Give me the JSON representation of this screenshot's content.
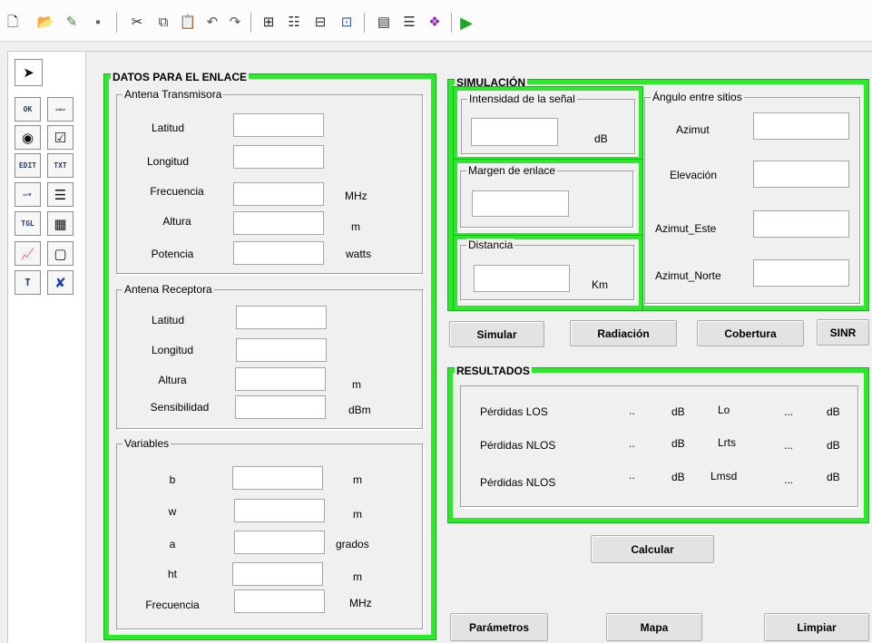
{
  "toolbar": {
    "icons": [
      "new-file-icon",
      "open-folder-icon",
      "edit-icon",
      "save-icon",
      "cut-icon",
      "copy-icon",
      "paste-icon",
      "undo-icon",
      "redo-icon",
      "align-icon",
      "menu-editor-icon",
      "tab-order-icon",
      "toolbar-editor-icon",
      "editor-icon",
      "property-inspector-icon",
      "object-browser-icon",
      "run-icon"
    ]
  },
  "palette": {
    "items": [
      {
        "icon": "pointer-icon",
        "text": "➤"
      },
      {
        "icon": "push-button-icon",
        "text": "OK"
      },
      {
        "icon": "slider-icon",
        "text": "▭▭"
      },
      {
        "icon": "radio-button-icon",
        "text": "◉"
      },
      {
        "icon": "checkbox-icon",
        "text": "☑"
      },
      {
        "icon": "edit-text-icon",
        "text": "EDIT"
      },
      {
        "icon": "static-text-icon",
        "text": "TXT"
      },
      {
        "icon": "popup-menu-icon",
        "text": "▭▾"
      },
      {
        "icon": "listbox-icon",
        "text": "☰"
      },
      {
        "icon": "toggle-button-icon",
        "text": "TGL"
      },
      {
        "icon": "table-icon",
        "text": "▦"
      },
      {
        "icon": "axes-icon",
        "text": "📈"
      },
      {
        "icon": "panel-icon",
        "text": "▢"
      },
      {
        "icon": "button-group-icon",
        "text": "T"
      },
      {
        "icon": "activex-icon",
        "text": "✘"
      }
    ]
  },
  "enlace": {
    "title": "DATOS PARA EL ENLACE",
    "tx": {
      "title": "Antena Transmisora",
      "rows": [
        {
          "label": "Latitud",
          "unit": ""
        },
        {
          "label": "Longitud",
          "unit": ""
        },
        {
          "label": "Frecuencia",
          "unit": "MHz"
        },
        {
          "label": "Altura",
          "unit": "m"
        },
        {
          "label": "Potencia",
          "unit": "watts"
        }
      ]
    },
    "rx": {
      "title": "Antena Receptora",
      "rows": [
        {
          "label": "Latitud",
          "unit": ""
        },
        {
          "label": "Longitud",
          "unit": ""
        },
        {
          "label": "Altura",
          "unit": "m"
        },
        {
          "label": "Sensibilidad",
          "unit": "dBm"
        }
      ]
    },
    "vars": {
      "title": "Variables",
      "rows": [
        {
          "label": "b",
          "unit": "m"
        },
        {
          "label": "w",
          "unit": "m"
        },
        {
          "label": "a",
          "unit": "grados"
        },
        {
          "label": "ht",
          "unit": "m"
        },
        {
          "label": "Frecuencia",
          "unit": "MHz"
        }
      ]
    }
  },
  "simulacion": {
    "title": "SIMULACIÓN",
    "intensidad": {
      "title": "Intensidad de la señal",
      "unit": "dB"
    },
    "margen": {
      "title": "Margen de enlace"
    },
    "distancia": {
      "title": "Distancia",
      "unit": "Km"
    },
    "angulo": {
      "title": "Ángulo entre sitios",
      "rows": [
        "Azimut",
        "Elevación",
        "Azimut_Este",
        "Azimut_Norte"
      ]
    }
  },
  "buttons": {
    "simular": "Simular",
    "radiacion": "Radiación",
    "cobertura": "Cobertura",
    "sinr": "SINR",
    "calcular": "Calcular",
    "parametros": "Parámetros",
    "mapa": "Mapa",
    "limpiar": "Limpiar"
  },
  "resultados": {
    "title": "RESULTADOS",
    "rows": [
      {
        "label": "Pérdidas LOS",
        "v1": "..",
        "u1": "dB",
        "label2": "Lo",
        "v2": "...",
        "u2": "dB"
      },
      {
        "label": "Pérdidas NLOS",
        "v1": "..",
        "u1": "dB",
        "label2": "Lrts",
        "v2": "...",
        "u2": "dB"
      },
      {
        "label": "Pérdidas NLOS",
        "v1": "..",
        "u1": "dB",
        "label2": "Lmsd",
        "v2": "...",
        "u2": "dB"
      }
    ]
  },
  "colors": {
    "accent": "#2ee82e",
    "panel_bg": "#f0f0f0"
  }
}
